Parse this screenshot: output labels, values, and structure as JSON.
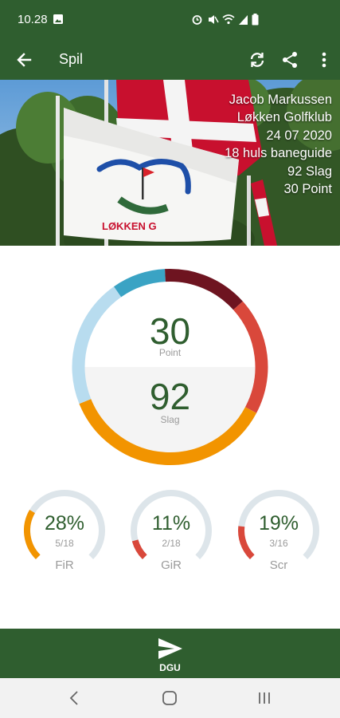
{
  "status": {
    "time": "10.28",
    "icons": [
      "image-icon",
      "alarm-icon",
      "mute-icon",
      "wifi-icon",
      "signal-icon",
      "battery-icon"
    ]
  },
  "appbar": {
    "title": "Spil",
    "back_icon": "arrow-left-icon",
    "actions": [
      "sync-icon",
      "share-icon",
      "more-vert-icon"
    ]
  },
  "hero": {
    "player": "Jacob Markussen",
    "club": "Løkken Golfklub",
    "date": "24 07 2020",
    "course": "18 huls baneguide",
    "strokes_text": "92 Slag",
    "points_text": "30 Point",
    "flag_text": "LØKKEN G"
  },
  "summary": {
    "points": "30",
    "points_label": "Point",
    "strokes": "92",
    "strokes_label": "Slag"
  },
  "stats": [
    {
      "pct": "28%",
      "frac": "5/18",
      "label": "FiR",
      "fraction": 0.28,
      "color": "#f29400"
    },
    {
      "pct": "11%",
      "frac": "2/18",
      "label": "GiR",
      "fraction": 0.11,
      "color": "#d9483b"
    },
    {
      "pct": "19%",
      "frac": "3/16",
      "label": "Scr",
      "fraction": 0.19,
      "color": "#d9483b"
    }
  ],
  "bottom": {
    "label": "DGU",
    "icon": "send-icon"
  },
  "nav": [
    "back-nav-icon",
    "home-nav-icon",
    "recents-nav-icon"
  ],
  "colors": {
    "primary": "#2f5e2f",
    "light_blue": "#b8dcef",
    "teal": "#3aa3c4",
    "dark_red": "#6e1420",
    "red": "#d9483b",
    "orange": "#f29400",
    "track": "#dde5ea"
  }
}
